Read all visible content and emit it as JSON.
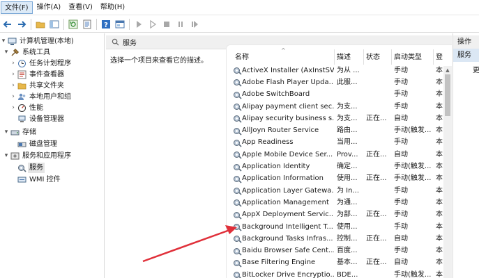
{
  "menubar": {
    "items": [
      {
        "label": "文件(F)"
      },
      {
        "label": "操作(A)"
      },
      {
        "label": "查看(V)"
      },
      {
        "label": "帮助(H)"
      }
    ]
  },
  "toolbar": {
    "icons": [
      "back-arrow-icon",
      "forward-arrow-icon",
      "folder-icon",
      "console-tree-icon",
      "refresh-icon",
      "export-list-icon",
      "help-icon",
      "properties-icon",
      "play-icon",
      "play-outline-icon",
      "stop-icon",
      "pause-icon",
      "restart-icon"
    ]
  },
  "tree": {
    "items": [
      {
        "label": "计算机管理(本地)",
        "icon": "computer-management-icon",
        "twisty": "▾",
        "indent": 0
      },
      {
        "label": "系统工具",
        "icon": "system-tools-icon",
        "twisty": "▾",
        "indent": 1
      },
      {
        "label": "任务计划程序",
        "icon": "task-scheduler-icon",
        "twisty": "›",
        "indent": 2
      },
      {
        "label": "事件查看器",
        "icon": "event-viewer-icon",
        "twisty": "›",
        "indent": 2
      },
      {
        "label": "共享文件夹",
        "icon": "shared-folders-icon",
        "twisty": "›",
        "indent": 2
      },
      {
        "label": "本地用户和组",
        "icon": "users-icon",
        "twisty": "›",
        "indent": 2
      },
      {
        "label": "性能",
        "icon": "performance-icon",
        "twisty": "›",
        "indent": 2
      },
      {
        "label": "设备管理器",
        "icon": "device-manager-icon",
        "twisty": "",
        "indent": 2
      },
      {
        "label": "存储",
        "icon": "storage-icon",
        "twisty": "▾",
        "indent": 1
      },
      {
        "label": "磁盘管理",
        "icon": "disk-management-icon",
        "twisty": "",
        "indent": 2
      },
      {
        "label": "服务和应用程序",
        "icon": "services-apps-icon",
        "twisty": "▾",
        "indent": 1
      },
      {
        "label": "服务",
        "icon": "services-icon",
        "twisty": "",
        "indent": 2,
        "selected": true
      },
      {
        "label": "WMI 控件",
        "icon": "wmi-icon",
        "twisty": "",
        "indent": 2
      }
    ]
  },
  "center": {
    "header_title": "服务",
    "description_hint": "选择一个项目来查看它的描述。",
    "columns": {
      "name": "名称",
      "desc": "描述",
      "status": "状态",
      "startup": "启动类型",
      "login": "登"
    },
    "services": [
      {
        "name": "ActiveX Installer (AxInstSV)",
        "desc": "为从 ...",
        "status": "",
        "startup": "手动",
        "login": "本"
      },
      {
        "name": "Adobe Flash Player Upda...",
        "desc": "此服...",
        "status": "",
        "startup": "手动",
        "login": "本"
      },
      {
        "name": "Adobe SwitchBoard",
        "desc": "",
        "status": "",
        "startup": "手动",
        "login": "本"
      },
      {
        "name": "Alipay payment client sec...",
        "desc": "为支...",
        "status": "",
        "startup": "手动",
        "login": "本"
      },
      {
        "name": "Alipay security business s...",
        "desc": "为支...",
        "status": "正在...",
        "startup": "自动",
        "login": "本"
      },
      {
        "name": "AllJoyn Router Service",
        "desc": "路由...",
        "status": "",
        "startup": "手动(触发...",
        "login": "本"
      },
      {
        "name": "App Readiness",
        "desc": "当用...",
        "status": "",
        "startup": "手动",
        "login": "本"
      },
      {
        "name": "Apple Mobile Device Ser...",
        "desc": "Prov...",
        "status": "正在...",
        "startup": "自动",
        "login": "本"
      },
      {
        "name": "Application Identity",
        "desc": "确定...",
        "status": "",
        "startup": "手动(触发...",
        "login": "本"
      },
      {
        "name": "Application Information",
        "desc": "使用...",
        "status": "正在...",
        "startup": "手动(触发...",
        "login": "本"
      },
      {
        "name": "Application Layer Gatewa...",
        "desc": "为 In...",
        "status": "",
        "startup": "手动",
        "login": "本"
      },
      {
        "name": "Application Management",
        "desc": "为通...",
        "status": "",
        "startup": "手动",
        "login": "本"
      },
      {
        "name": "AppX Deployment Servic...",
        "desc": "为部...",
        "status": "正在...",
        "startup": "手动",
        "login": "本"
      },
      {
        "name": "Background Intelligent T...",
        "desc": "使用...",
        "status": "",
        "startup": "手动",
        "login": "本"
      },
      {
        "name": "Background Tasks Infras...",
        "desc": "控制...",
        "status": "正在...",
        "startup": "自动",
        "login": "本"
      },
      {
        "name": "Baidu Browser Safe Cent...",
        "desc": "百度...",
        "status": "",
        "startup": "手动",
        "login": "本"
      },
      {
        "name": "Base Filtering Engine",
        "desc": "基本...",
        "status": "正在...",
        "startup": "自动",
        "login": "本"
      },
      {
        "name": "BitLocker Drive Encryptio...",
        "desc": "BDE...",
        "status": "",
        "startup": "手动(触发...",
        "login": "本"
      }
    ]
  },
  "actions": {
    "title": "操作",
    "selected_label": "服务",
    "more_label": "更"
  },
  "colors": {
    "arrow": "#e0303a",
    "selected_action_bg": "#dbe7f4",
    "header_bg": "#f0f0f0"
  }
}
